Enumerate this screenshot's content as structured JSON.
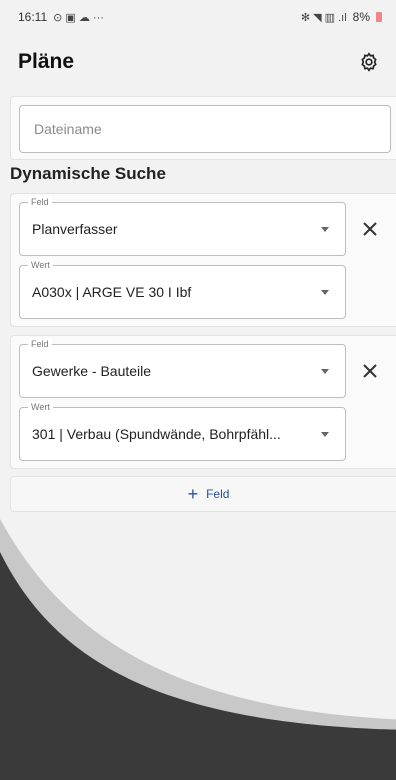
{
  "status_bar": {
    "time": "16:11",
    "left_icons": "⊙ ▣ ☁ ···",
    "right_icons": "✻ ◥ ▥ .ıl",
    "battery": "8%"
  },
  "header": {
    "title": "Pläne"
  },
  "file_search": {
    "placeholder": "Dateiname"
  },
  "dynamic_search": {
    "title": "Dynamische Suche",
    "filters": [
      {
        "field_label": "Feld",
        "field_value": "Planverfasser",
        "value_label": "Wert",
        "value_value": "A030x | ARGE VE 30 I Ibf"
      },
      {
        "field_label": "Feld",
        "field_value": "Gewerke - Bauteile",
        "value_label": "Wert",
        "value_value": "301 | Verbau (Spundwände, Bohrpfähl..."
      }
    ],
    "add_label": "Feld"
  },
  "colors": {
    "accent": "#2c4f9c",
    "background": "#f2f2f2",
    "dark_shape": "#3a3a3a"
  }
}
